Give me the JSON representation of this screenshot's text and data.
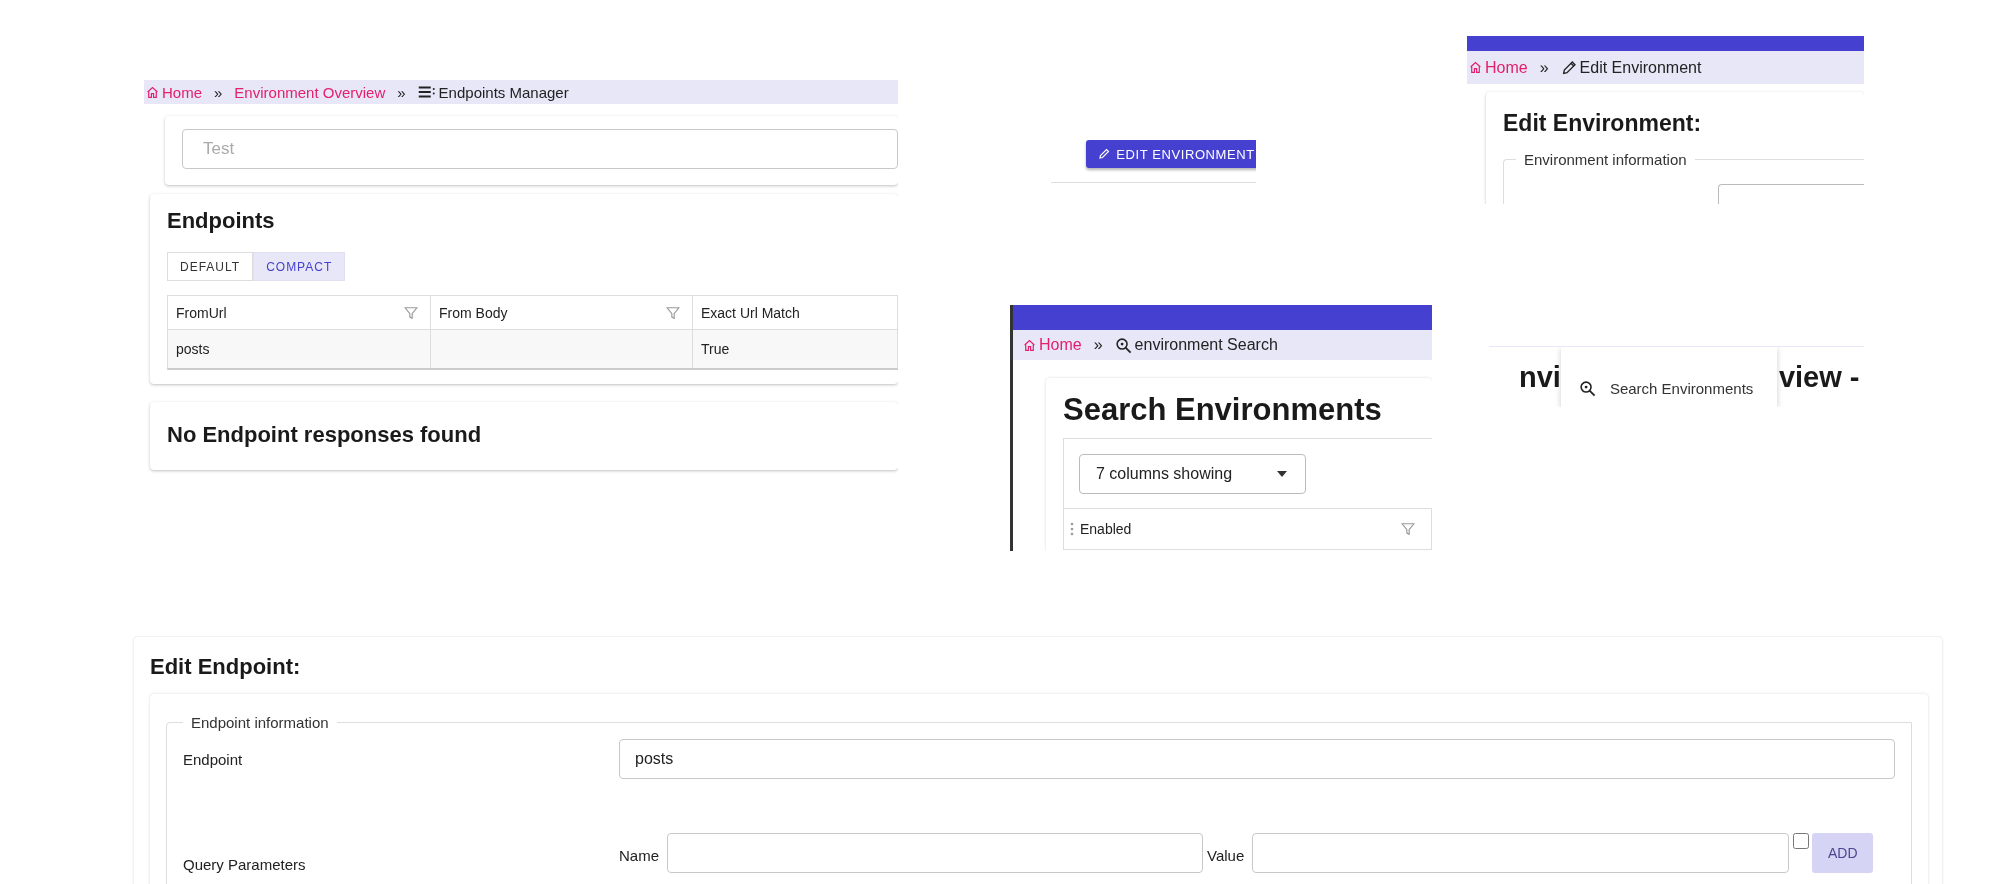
{
  "endpoints_manager": {
    "breadcrumb": {
      "crumbs": [
        {
          "label": "Home",
          "link": true
        },
        {
          "label": "Environment Overview",
          "link": true
        },
        {
          "label": "Endpoints Manager",
          "link": false
        }
      ],
      "separators": [
        "»",
        "»"
      ]
    },
    "filter_field": {
      "placeholder": "Test"
    },
    "endpoints": {
      "title": "Endpoints",
      "density": [
        {
          "label": "DEFAULT",
          "selected": false
        },
        {
          "label": "COMPACT",
          "selected": true
        }
      ],
      "columns": [
        {
          "label": "FromUrl",
          "filter": true
        },
        {
          "label": "From Body",
          "filter": true
        },
        {
          "label": "Exact Url Match",
          "filter": false
        }
      ],
      "rows": [
        [
          "posts",
          "",
          "True"
        ]
      ]
    },
    "responses": {
      "title": "No Endpoint responses found"
    }
  },
  "edit_environment_button": {
    "label": "EDIT ENVIRONMENT"
  },
  "environment_search": {
    "breadcrumb": {
      "crumbs": [
        {
          "label": "Home",
          "link": true
        },
        {
          "label": "environment Search",
          "link": false
        }
      ],
      "separators": [
        "»"
      ]
    },
    "title": "Search Environments",
    "columns_select": {
      "value": "7 columns showing"
    },
    "columns": [
      {
        "label": "Enabled",
        "filter": true
      }
    ]
  },
  "edit_environment": {
    "breadcrumb": {
      "crumbs": [
        {
          "label": "Home",
          "link": true
        },
        {
          "label": "Edit Environment",
          "link": false
        }
      ],
      "separators": [
        "»"
      ]
    },
    "title": "Edit Environment:",
    "legend": "Environment information"
  },
  "overview_heading": {
    "left": "nvi",
    "right": "view -",
    "menu": [
      {
        "label": "Search Environments"
      }
    ]
  },
  "edit_endpoint": {
    "title": "Edit Endpoint:",
    "legend": "Endpoint information",
    "endpoint": {
      "label": "Endpoint",
      "value": "posts"
    },
    "query_parameters": {
      "label": "Query Parameters",
      "name_label": "Name",
      "value_label": "Value",
      "checkbox": {
        "checked": false
      },
      "add_button": {
        "label": "ADD",
        "disabled": true
      }
    }
  }
}
